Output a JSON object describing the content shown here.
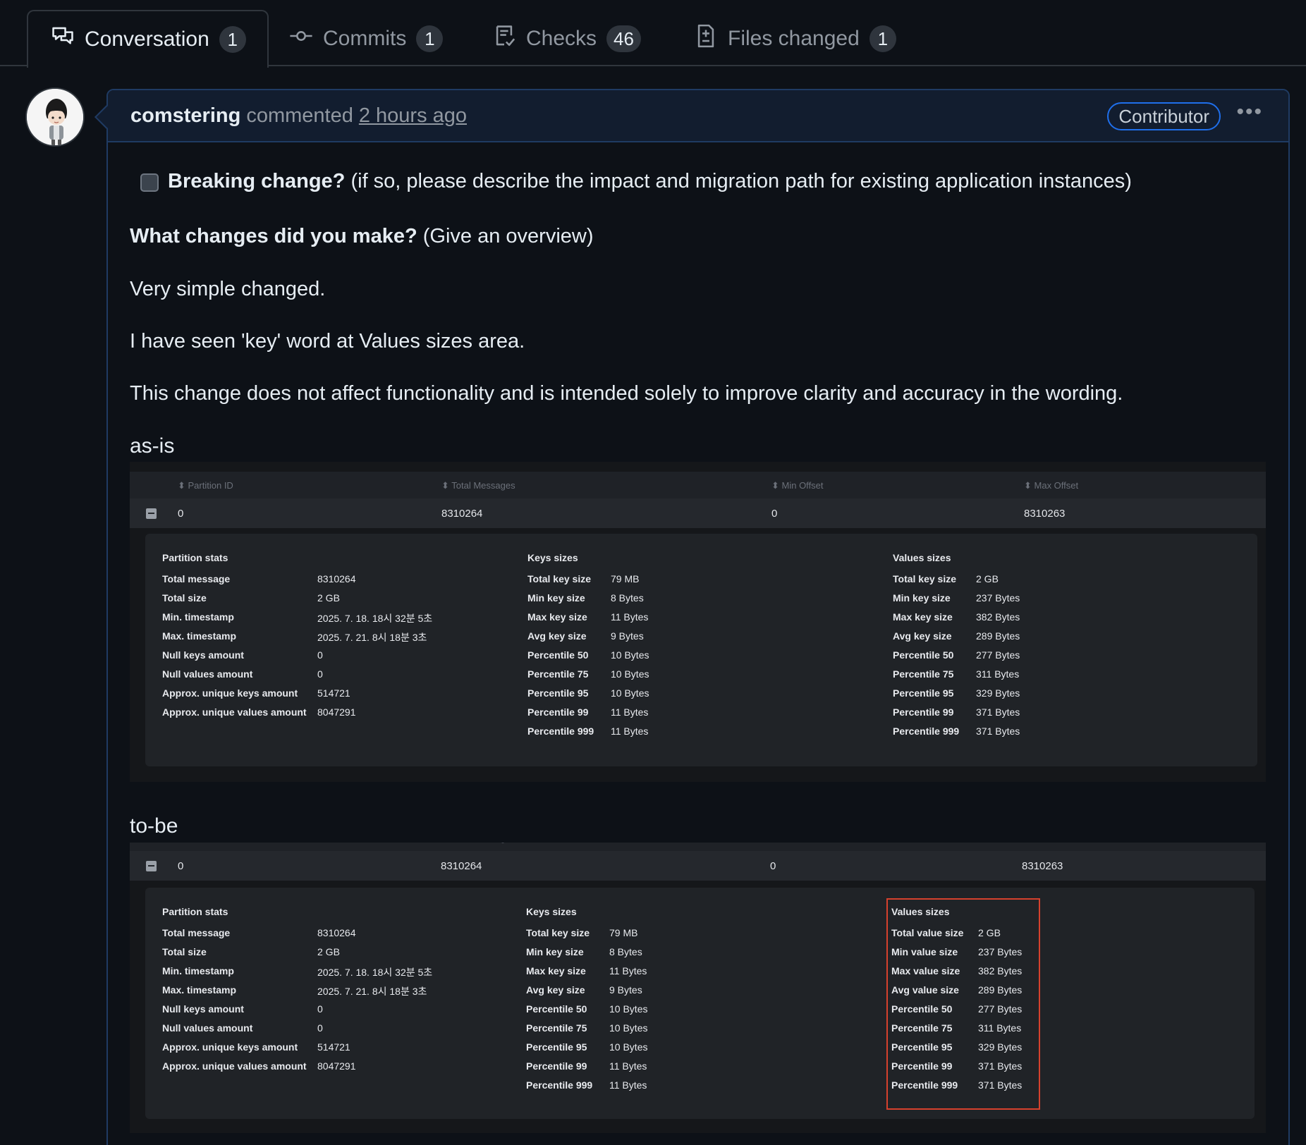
{
  "tabs": [
    {
      "label": "Conversation",
      "count": "1"
    },
    {
      "label": "Commits",
      "count": "1"
    },
    {
      "label": "Checks",
      "count": "46"
    },
    {
      "label": "Files changed",
      "count": "1"
    }
  ],
  "comment": {
    "author": "comstering",
    "verb": "commented",
    "time": "2 hours ago",
    "badge": "Contributor",
    "menu": "•••"
  },
  "body": {
    "breaking_bold": "Breaking change?",
    "breaking_rest": " (if so, please describe the impact and migration path for existing application instances)",
    "what_bold": "What changes did you make?",
    "what_rest": " (Give an overview)",
    "p1": "Very simple changed.",
    "p2": "I have seen 'key' word at Values sizes area.",
    "p3": "This change does not affect functionality and is intended solely to improve clarity and accuracy in the wording.",
    "asis": "as-is",
    "tobe": "to-be"
  },
  "table": {
    "headers": [
      "Partition ID",
      "Total Messages",
      "Min Offset",
      "Max Offset"
    ],
    "row": [
      "0",
      "8310264",
      "0",
      "8310263"
    ]
  },
  "partition_stats": {
    "title": "Partition stats",
    "items": [
      {
        "k": "Total message",
        "v": "8310264"
      },
      {
        "k": "Total size",
        "v": "2 GB"
      },
      {
        "k": "Min. timestamp",
        "v": "2025. 7. 18. 18시 32분 5초"
      },
      {
        "k": "Max. timestamp",
        "v": "2025. 7. 21. 8시 18분 3초"
      },
      {
        "k": "Null keys amount",
        "v": "0"
      },
      {
        "k": "Null values amount",
        "v": "0"
      },
      {
        "k": "Approx. unique keys amount",
        "v": "514721"
      },
      {
        "k": "Approx. unique values amount",
        "v": "8047291"
      }
    ]
  },
  "keys_sizes": {
    "title": "Keys sizes",
    "items": [
      {
        "k": "Total key size",
        "v": "79 MB"
      },
      {
        "k": "Min key size",
        "v": "8 Bytes"
      },
      {
        "k": "Max key size",
        "v": "11 Bytes"
      },
      {
        "k": "Avg key size",
        "v": "9 Bytes"
      },
      {
        "k": "Percentile 50",
        "v": "10 Bytes"
      },
      {
        "k": "Percentile 75",
        "v": "10 Bytes"
      },
      {
        "k": "Percentile 95",
        "v": "10 Bytes"
      },
      {
        "k": "Percentile 99",
        "v": "11 Bytes"
      },
      {
        "k": "Percentile 999",
        "v": "11 Bytes"
      }
    ]
  },
  "values_sizes_asis": {
    "title": "Values sizes",
    "items": [
      {
        "k": "Total key size",
        "v": "2 GB"
      },
      {
        "k": "Min key size",
        "v": "237 Bytes"
      },
      {
        "k": "Max key size",
        "v": "382 Bytes"
      },
      {
        "k": "Avg key size",
        "v": "289 Bytes"
      },
      {
        "k": "Percentile 50",
        "v": "277 Bytes"
      },
      {
        "k": "Percentile 75",
        "v": "311 Bytes"
      },
      {
        "k": "Percentile 95",
        "v": "329 Bytes"
      },
      {
        "k": "Percentile 99",
        "v": "371 Bytes"
      },
      {
        "k": "Percentile 999",
        "v": "371 Bytes"
      }
    ]
  },
  "values_sizes_tobe": {
    "title": "Values sizes",
    "items": [
      {
        "k": "Total value size",
        "v": "2 GB"
      },
      {
        "k": "Min value size",
        "v": "237 Bytes"
      },
      {
        "k": "Max value size",
        "v": "382 Bytes"
      },
      {
        "k": "Avg value size",
        "v": "289 Bytes"
      },
      {
        "k": "Percentile 50",
        "v": "277 Bytes"
      },
      {
        "k": "Percentile 75",
        "v": "311 Bytes"
      },
      {
        "k": "Percentile 95",
        "v": "329 Bytes"
      },
      {
        "k": "Percentile 99",
        "v": "371 Bytes"
      },
      {
        "k": "Percentile 999",
        "v": "371 Bytes"
      }
    ]
  },
  "colors": {
    "background": "#0d1117",
    "border": "#30363d",
    "comment_header": "#121d2f",
    "accent_blue": "#1f6feb",
    "highlight_red": "#d6412d"
  },
  "icons": {
    "conversation": "comment-discussion-icon",
    "commits": "git-commit-icon",
    "checks": "checklist-icon",
    "files": "file-diff-icon"
  }
}
